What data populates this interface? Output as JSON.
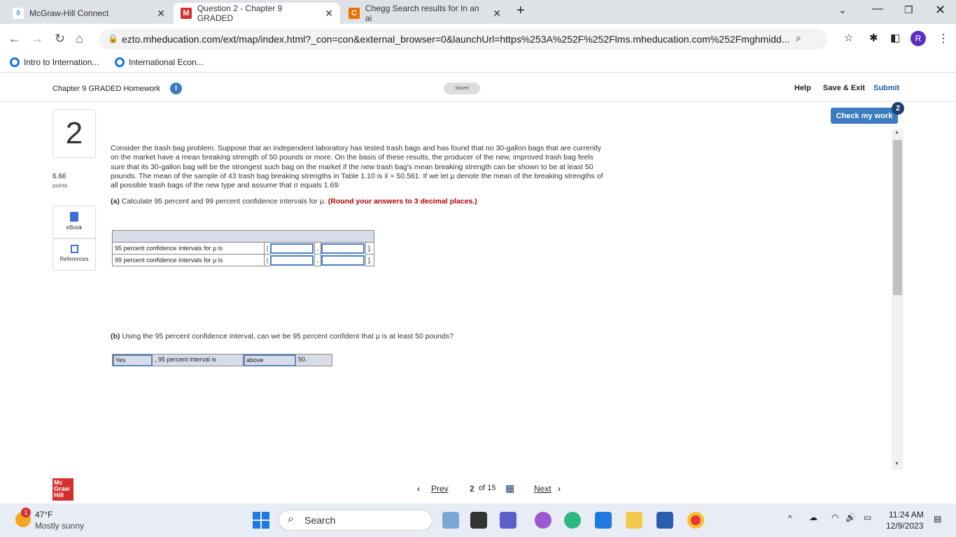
{
  "browser": {
    "tabs": [
      {
        "title": "McGraw-Hill Connect",
        "active": false
      },
      {
        "title": "Question 2 - Chapter 9 GRADED",
        "active": true
      },
      {
        "title": "Chegg Search results for In an ai",
        "active": false
      }
    ],
    "url": "ezto.mheducation.com/ext/map/index.html?_con=con&external_browser=0&launchUrl=https%253A%252F%252Flms.mheducation.com%252Fmghmidd...",
    "profile_initial": "R",
    "bookmarks": [
      "Intro to Internation...",
      "International Econ..."
    ]
  },
  "header": {
    "title": "Chapter 9 GRADED Homework",
    "status": "Saved",
    "help": "Help",
    "save_exit": "Save & Exit",
    "submit": "Submit",
    "check_label": "Check my work",
    "check_badge": "2"
  },
  "question": {
    "number": "2",
    "points": "6.66",
    "points_label": "points",
    "ebook": "eBook",
    "references": "References",
    "text": "Consider the trash bag problem. Suppose that an independent laboratory has tested trash bags and has found that no 30-gallon bags that are currently on the market have a mean breaking strength of 50 pounds or more. On the basis of these results, the producer of the new, improved trash bag feels sure that its 30-gallon bag will be the strongest such bag on the market if the new trash bag's mean breaking strength can be shown to be at least 50 pounds. The mean of the sample of 43 trash bag breaking strengths in Table 1.10 is x̄ = 50.561. If we let μ denote the mean of the breaking strengths of all possible trash bags of the new type and assume that σ equals 1.69:",
    "part_a_label": "(a)",
    "part_a": " Calculate 95 percent and 99 percent confidence intervals for μ.",
    "part_a_note": " (Round your answers to 3 decimal places.)",
    "rows": [
      {
        "label": "95 percent confidence intervals for μ is",
        "low": "",
        "high": ""
      },
      {
        "label": "99 percent confidence intervals for μ is",
        "low": "",
        "high": ""
      }
    ],
    "open": "[",
    "sep": ",",
    "close": "].",
    "part_b_label": "(b)",
    "part_b": " Using the 95 percent confidence interval, can we be 95 percent confident that μ is at least 50 pounds?",
    "b_answer": "Yes",
    "b_mid": ", 95 percent interval is",
    "b_answer2": "above",
    "b_end": "50."
  },
  "footer": {
    "logo": "Mc Graw Hill",
    "prev": "Prev",
    "page": "2",
    "of": "of 15",
    "next": "Next"
  },
  "taskbar": {
    "temp": "47°F",
    "weather": "Mostly sunny",
    "weather_badge": "1",
    "search": "Search",
    "time": "11:24 AM",
    "date": "12/9/2023"
  }
}
